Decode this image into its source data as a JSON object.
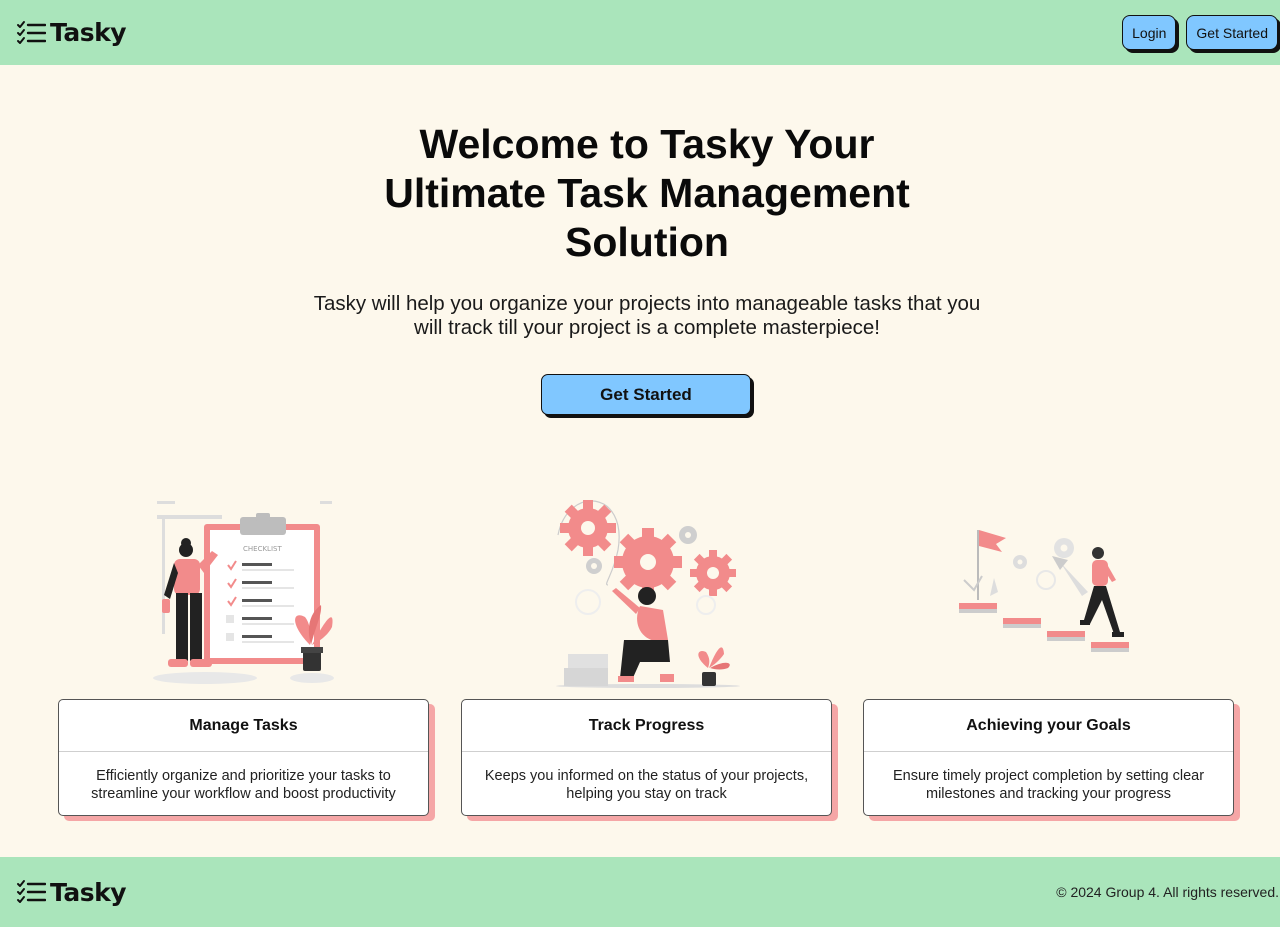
{
  "header": {
    "logo_text": "Tasky",
    "login_label": "Login",
    "get_started_label": "Get Started"
  },
  "hero": {
    "title": "Welcome to Tasky Your Ultimate Task Management Solution",
    "subtitle": "Tasky will help you organize your projects into manageable tasks that you will track till your project is a complete masterpiece!",
    "cta_label": "Get Started"
  },
  "illustrations": {
    "checklist_label": "CHECKLIST"
  },
  "features": [
    {
      "title": "Manage Tasks",
      "description": "Efficiently organize and prioritize your tasks to streamline your workflow and boost productivity"
    },
    {
      "title": "Track Progress",
      "description": "Keeps you informed on the status of your projects, helping you stay on track"
    },
    {
      "title": "Achieving your Goals",
      "description": "Ensure timely project completion by setting clear milestones and tracking your progress"
    }
  ],
  "footer": {
    "logo_text": "Tasky",
    "copyright": "© 2024 Group 4. All rights reserved."
  },
  "colors": {
    "header_bg": "#aae5bb",
    "page_bg": "#fdf8ec",
    "button_bg": "#80c7ff",
    "accent_pink": "#f28b8b",
    "card_shadow": "#f5a6a6"
  }
}
